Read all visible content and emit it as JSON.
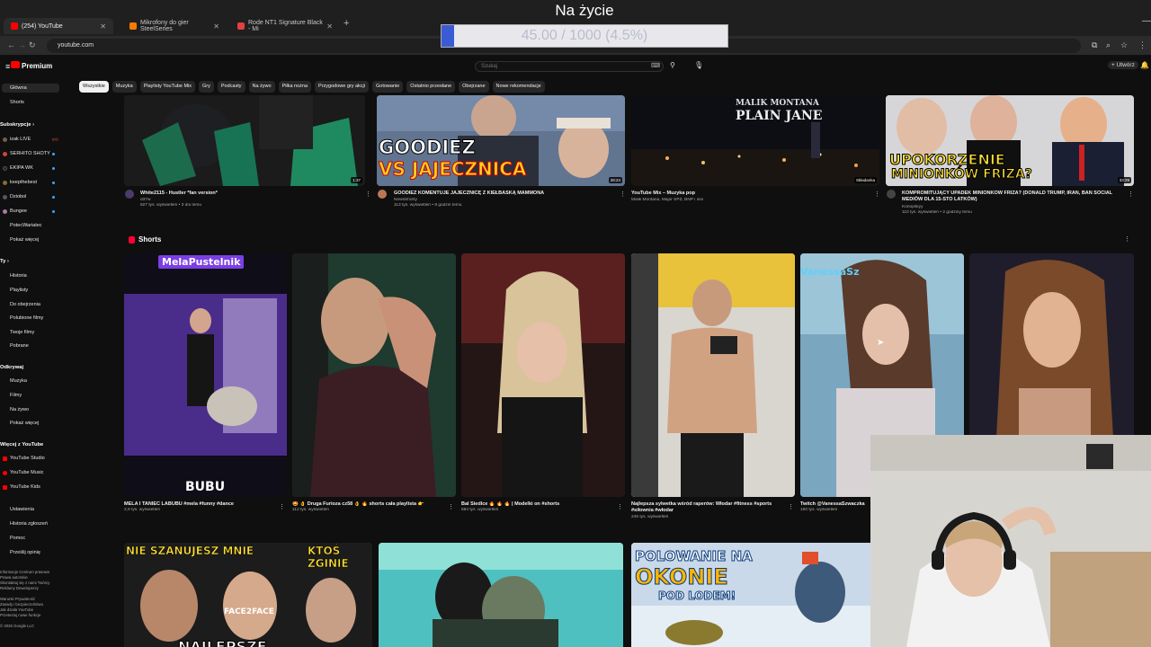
{
  "stream": {
    "title": "Na życie",
    "goal_text": "45.00 / 1000 (4.5%)",
    "goal_fraction": 0.045
  },
  "browser": {
    "tabs": [
      {
        "label": "(254) YouTube",
        "active": true,
        "favicon_color": "#ff0000"
      },
      {
        "label": "Mikrofony do gier SteelSeries",
        "active": false,
        "favicon_color": "#ff7a00"
      },
      {
        "label": "Rode NT1 Signature Black - Mi",
        "active": false,
        "favicon_color": "#e34040"
      }
    ],
    "url": "youtube.com"
  },
  "youtube": {
    "brand": "Premium",
    "search_placeholder": "Szukaj",
    "create_label": "Utwórz",
    "chips": [
      "Wszystkie",
      "Muzyka",
      "Playlisty YouTube Mix",
      "Gry",
      "Podcasty",
      "Na żywo",
      "Piłka nożna",
      "Przygodowe gry akcji",
      "Gotowanie",
      "Ostatnio przesłane",
      "Obejrzane",
      "Nowe rekomendacje"
    ]
  },
  "sidebar": {
    "main": [
      "Główna",
      "Shorts"
    ],
    "subscriptions_head": "Subskrypcje",
    "subscriptions": [
      "izak LIVE",
      "SERHITO SHOTY",
      "EKIPA WK",
      "keepthebest",
      "Dziobol",
      "Bungee",
      "PotecWariatec",
      "Pokaż więcej"
    ],
    "you_head": "Ty",
    "you_items": [
      "Historia",
      "Playlisty",
      "Do obejrzenia",
      "Polubione filmy",
      "Twoje filmy",
      "Pobrane"
    ],
    "explore_head": "Odkrywaj",
    "explore_items": [
      "Muzyka",
      "Filmy",
      "Na żywo",
      "Pokaż więcej"
    ],
    "more_head": "Więcej z YouTube",
    "more_items": [
      "YouTube Studio",
      "YouTube Music",
      "YouTube Kids"
    ],
    "settings_items": [
      "Ustawienia",
      "Historia zgłoszeń",
      "Pomoc",
      "Prześlij opinię"
    ],
    "footer_lines": [
      "Informacje  Centrum prasowe",
      "Prawa autorskie",
      "Skontaktuj się z nami  Twórcy",
      "Reklamy  Deweloperzy",
      "",
      "Warunki  Prywatność",
      "Zasady i bezpieczeństwo",
      "Jak działa YouTube",
      "Przetestuj nowe funkcje",
      "",
      "© 2025 Google LLC"
    ]
  },
  "videos_top": [
    {
      "title": "White2115 - Hustler *fan version*",
      "channel": "d37w",
      "stats": "827 tys. wyświetleń • 3 dni temu",
      "duration": "1:37"
    },
    {
      "title": "GOODIEZ KOMENTUJE JAJECZNICĘ Z KIEŁBASKĄ MAMMONA",
      "channel": "NewsShorty",
      "stats": "113 tys. wyświetleń • 8 godzin temu",
      "duration": "28:24",
      "overlay1": "GOODIEZ",
      "overlay2": "VS JAJECZNICA"
    },
    {
      "title": "YouTube Mix – Muzyka pop",
      "channel": "Malik Montana, Major SPZ, BNP i inni",
      "stats": "",
      "duration": "Składanka",
      "overlay1": "MALIK MONTANA",
      "overlay2": "PLAIN JANE"
    },
    {
      "title": "KOMPROMITUJĄCY UPADEK MINIONKÓW FRIZA? (DONALD TRUMP, IRAN, BAN SOCIAL MEDIÓW DLA 15-STO LATKÓW)",
      "channel": "Konopskyy",
      "stats": "110 tys. wyświetleń • 2 godziny temu",
      "duration": "33:29",
      "overlay1": "UPOKORZENIE",
      "overlay2": "MINIONKÓW FRIZA?"
    }
  ],
  "shorts": {
    "heading": "Shorts",
    "items": [
      {
        "title": "MELA I TANIEC LABUBU #mela #funny #dance",
        "stats": "2,9 tys. wyświetleń",
        "overlay_top": "MelaPustelnik",
        "overlay_bottom": "BUBU"
      },
      {
        "title": "🤩 👌 Druga Furioza cz58 👌 🔥 shorts cała playlista 👉",
        "stats": "112 tys. wyświetleń"
      },
      {
        "title": "Bal Siedlce 🔥 🔥 🔥 | Modelki on #shorts",
        "stats": "684 tys. wyświetleń"
      },
      {
        "title": "Najlepsza sylwetka wśród raperów: Włodar #fitness #sports #siłownia #włodar",
        "stats": "245 tys. wyświetleń"
      },
      {
        "title": "Twitch @VanessaSzwaczka",
        "stats": "160 tys. wyświetleń",
        "overlay_top": "VanessaSz"
      },
      {
        "title": "",
        "stats": ""
      }
    ]
  },
  "videos_bottom": [
    {
      "overlay1": "NIE SZANUJESZ MNIE",
      "overlay2": "KTOŚ ZGINIE",
      "overlay3": "FACE2FACE",
      "overlay4": "NAJLEPSZE"
    },
    {},
    {
      "overlay1": "POLOWANIE NA",
      "overlay2": "OKONIE",
      "overlay3": "POD LODEM!"
    }
  ]
}
